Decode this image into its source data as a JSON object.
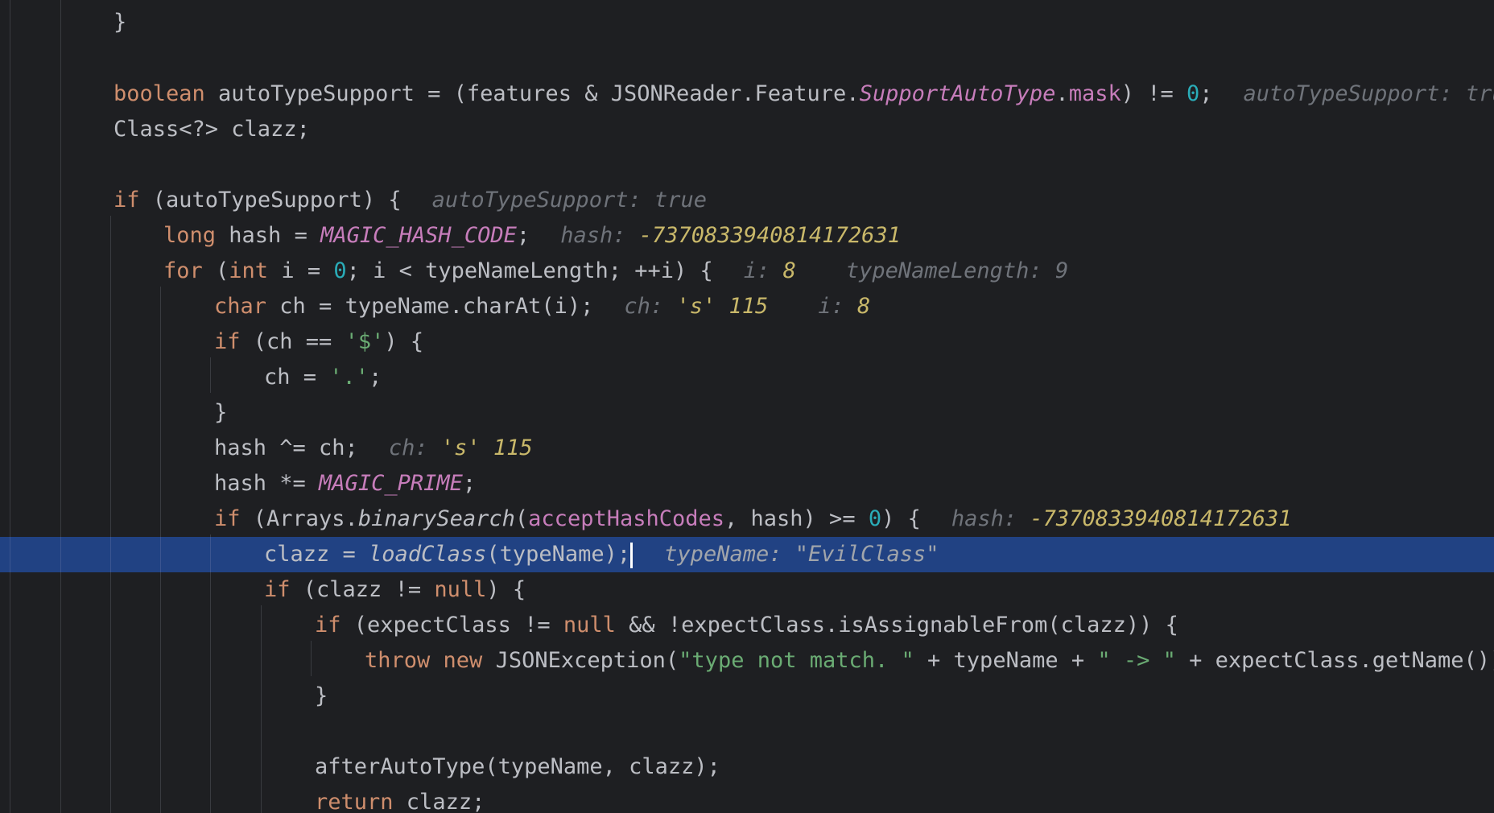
{
  "editor": {
    "theme_colors": {
      "background": "#1e1f22",
      "current_line": "#214283",
      "keyword": "#cf8e6d",
      "number": "#2aacb8",
      "string": "#6aab73",
      "constant": "#c77dbb",
      "inline_hint": "#6f737a",
      "hint_value": "#c9b86a"
    },
    "l1": {
      "close": "}"
    },
    "l3": {
      "kw": "boolean",
      "a": " autoTypeSupport = (features & JSONReader.Feature.",
      "feature": "SupportAutoType",
      "dot": ".",
      "mask": "mask",
      "b": ") != ",
      "zero": "0",
      "semi": ";",
      "hint_name": "autoTypeSupport:",
      "hint_value": "true"
    },
    "l4": {
      "text": "Class<?> clazz;"
    },
    "l6": {
      "kw": "if",
      "a": " (autoTypeSupport) {",
      "hint_name": "autoTypeSupport:",
      "hint_value": "true"
    },
    "l7": {
      "kw": "long",
      "a": " hash = ",
      "const": "MAGIC_HASH_CODE",
      "semi": ";",
      "hint_name": "hash:",
      "hint_value": "-7370833940814172631"
    },
    "l8": {
      "kw": "for",
      "a": " (",
      "kw2": "int",
      "b": " i = ",
      "zero": "0",
      "c": "; i < typeNameLength; ++i) {",
      "hint1_name": "i:",
      "hint1_value": "8",
      "hint2_name": "typeNameLength:",
      "hint2_value": "9"
    },
    "l9": {
      "kw": "char",
      "a": " ch = typeName.charAt(i);",
      "hint1_name": "ch:",
      "hint1_value": "'s' 115",
      "hint2_name": "i:",
      "hint2_value": "8"
    },
    "l10": {
      "kw": "if",
      "a": " (ch == ",
      "str": "'$'",
      "b": ") {"
    },
    "l11": {
      "a": "ch = ",
      "str": "'.'",
      "semi": ";"
    },
    "l12": {
      "close": "}"
    },
    "l13": {
      "a": "hash ^= ch;",
      "hint_name": "ch:",
      "hint_value": "'s' 115"
    },
    "l14": {
      "a": "hash *= ",
      "const": "MAGIC_PRIME",
      "semi": ";"
    },
    "l15": {
      "kw": "if",
      "a": " (Arrays.",
      "method": "binarySearch",
      "b": "(",
      "field": "acceptHashCodes",
      "c": ", hash) >= ",
      "zero": "0",
      "d": ") {",
      "hint_name": "hash:",
      "hint_value": "-7370833940814172631"
    },
    "l16": {
      "a": "clazz = ",
      "method": "loadClass",
      "b": "(typeName);",
      "hint_name": "typeName:",
      "hint_value": "\"EvilClass\""
    },
    "l17": {
      "kw": "if",
      "a": " (clazz != ",
      "kw2": "null",
      "b": ") {"
    },
    "l18": {
      "kw": "if",
      "a": " (expectClass != ",
      "kw2": "null",
      "b": " && !expectClass.isAssignableFrom(clazz)) {"
    },
    "l19": {
      "kw": "throw",
      "sp": " ",
      "kw2": "new",
      "a": " JSONException(",
      "str1": "\"type not match. \"",
      "b": " + typeName + ",
      "str2": "\" -> \"",
      "c": " + expectClass.getName());"
    },
    "l20": {
      "close": "}"
    },
    "l22": {
      "a": "afterAutoType(typeName, clazz);"
    },
    "l23": {
      "kw": "return",
      "a": " clazz;"
    }
  }
}
